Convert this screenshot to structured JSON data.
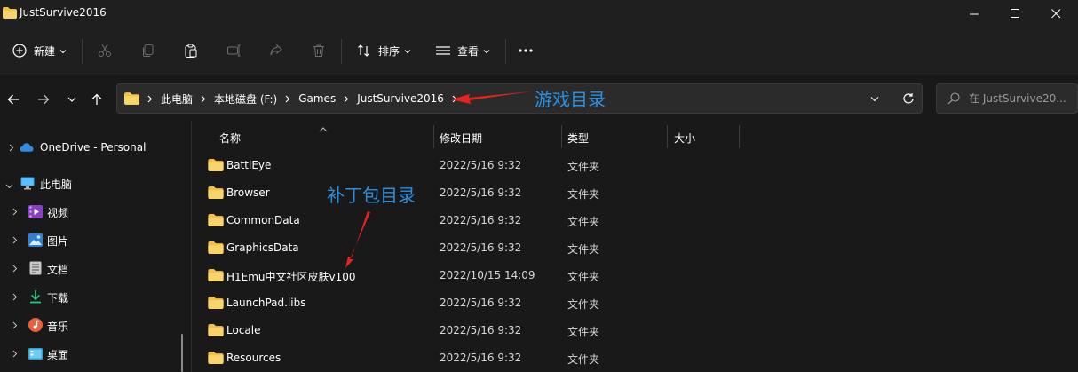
{
  "window": {
    "title": "JustSurvive2016"
  },
  "toolbar": {
    "new_label": "新建",
    "sort_label": "排序",
    "view_label": "查看",
    "more_label": "···"
  },
  "address": {
    "crumbs": [
      "此电脑",
      "本地磁盘 (F:)",
      "Games",
      "JustSurvive2016"
    ]
  },
  "search": {
    "placeholder": "在 JustSurvive20..."
  },
  "sidebar": {
    "items": [
      {
        "label": "OneDrive - Personal",
        "icon": "cloud-icon"
      },
      {
        "label": "此电脑",
        "icon": "computer-icon"
      },
      {
        "label": "视频",
        "icon": "video-icon"
      },
      {
        "label": "图片",
        "icon": "picture-icon"
      },
      {
        "label": "文档",
        "icon": "document-icon"
      },
      {
        "label": "下载",
        "icon": "download-icon"
      },
      {
        "label": "音乐",
        "icon": "music-icon"
      },
      {
        "label": "桌面",
        "icon": "desktop-icon"
      }
    ]
  },
  "columns": {
    "name": "名称",
    "modified": "修改日期",
    "type": "类型",
    "size": "大小"
  },
  "files": [
    {
      "name": "BattlEye",
      "modified": "2022/5/16 9:32",
      "type": "文件夹"
    },
    {
      "name": "Browser",
      "modified": "2022/5/16 9:32",
      "type": "文件夹"
    },
    {
      "name": "CommonData",
      "modified": "2022/5/16 9:32",
      "type": "文件夹"
    },
    {
      "name": "GraphicsData",
      "modified": "2022/5/16 9:32",
      "type": "文件夹"
    },
    {
      "name": "H1Emu中文社区皮肤v100",
      "modified": "2022/10/15 14:09",
      "type": "文件夹"
    },
    {
      "name": "LaunchPad.libs",
      "modified": "2022/5/16 9:32",
      "type": "文件夹"
    },
    {
      "name": "Locale",
      "modified": "2022/5/16 9:32",
      "type": "文件夹"
    },
    {
      "name": "Resources",
      "modified": "2022/5/16 9:32",
      "type": "文件夹"
    }
  ],
  "annotations": {
    "game_dir": "游戏目录",
    "patch_dir": "补丁包目录"
  },
  "colors": {
    "folder": "#f3c14b",
    "annotation": "#2b8fe0",
    "arrow": "#e8231f",
    "background": "#191919"
  }
}
